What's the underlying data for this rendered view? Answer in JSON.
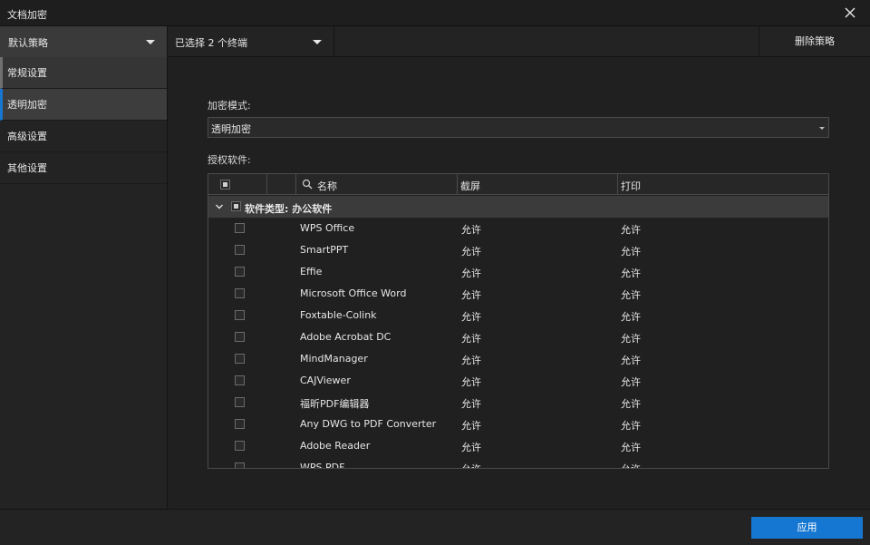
{
  "window": {
    "title": "文档加密"
  },
  "toolbar": {
    "policy": "默认策略",
    "terminals": "已选择 2 个终端",
    "delete": "删除策略"
  },
  "sidebar": {
    "items": [
      {
        "label": "常规设置"
      },
      {
        "label": "透明加密"
      },
      {
        "label": "高级设置"
      },
      {
        "label": "其他设置"
      }
    ]
  },
  "main": {
    "mode_label": "加密模式:",
    "mode_value": "透明加密",
    "software_label": "授权软件:",
    "columns": {
      "name": "名称",
      "screenshot": "截屏",
      "print": "打印"
    },
    "group": "软件类型: 办公软件",
    "rows": [
      {
        "name": "WPS Office",
        "screenshot": "允许",
        "print": "允许"
      },
      {
        "name": "SmartPPT",
        "screenshot": "允许",
        "print": "允许"
      },
      {
        "name": "Effie",
        "screenshot": "允许",
        "print": "允许"
      },
      {
        "name": "Microsoft Office Word",
        "screenshot": "允许",
        "print": "允许"
      },
      {
        "name": "Foxtable-Colink",
        "screenshot": "允许",
        "print": "允许"
      },
      {
        "name": "Adobe Acrobat DC",
        "screenshot": "允许",
        "print": "允许"
      },
      {
        "name": "MindManager",
        "screenshot": "允许",
        "print": "允许"
      },
      {
        "name": "CAJViewer",
        "screenshot": "允许",
        "print": "允许"
      },
      {
        "name": "福昕PDF编辑器",
        "screenshot": "允许",
        "print": "允许"
      },
      {
        "name": "Any DWG to PDF Converter",
        "screenshot": "允许",
        "print": "允许"
      },
      {
        "name": "Adobe Reader",
        "screenshot": "允许",
        "print": "允许"
      },
      {
        "name": "WPS PDF",
        "screenshot": "允许",
        "print": "允许"
      }
    ]
  },
  "footer": {
    "apply": "应用"
  },
  "colors": {
    "accent": "#1677d2",
    "background": "#1e1e1e"
  }
}
